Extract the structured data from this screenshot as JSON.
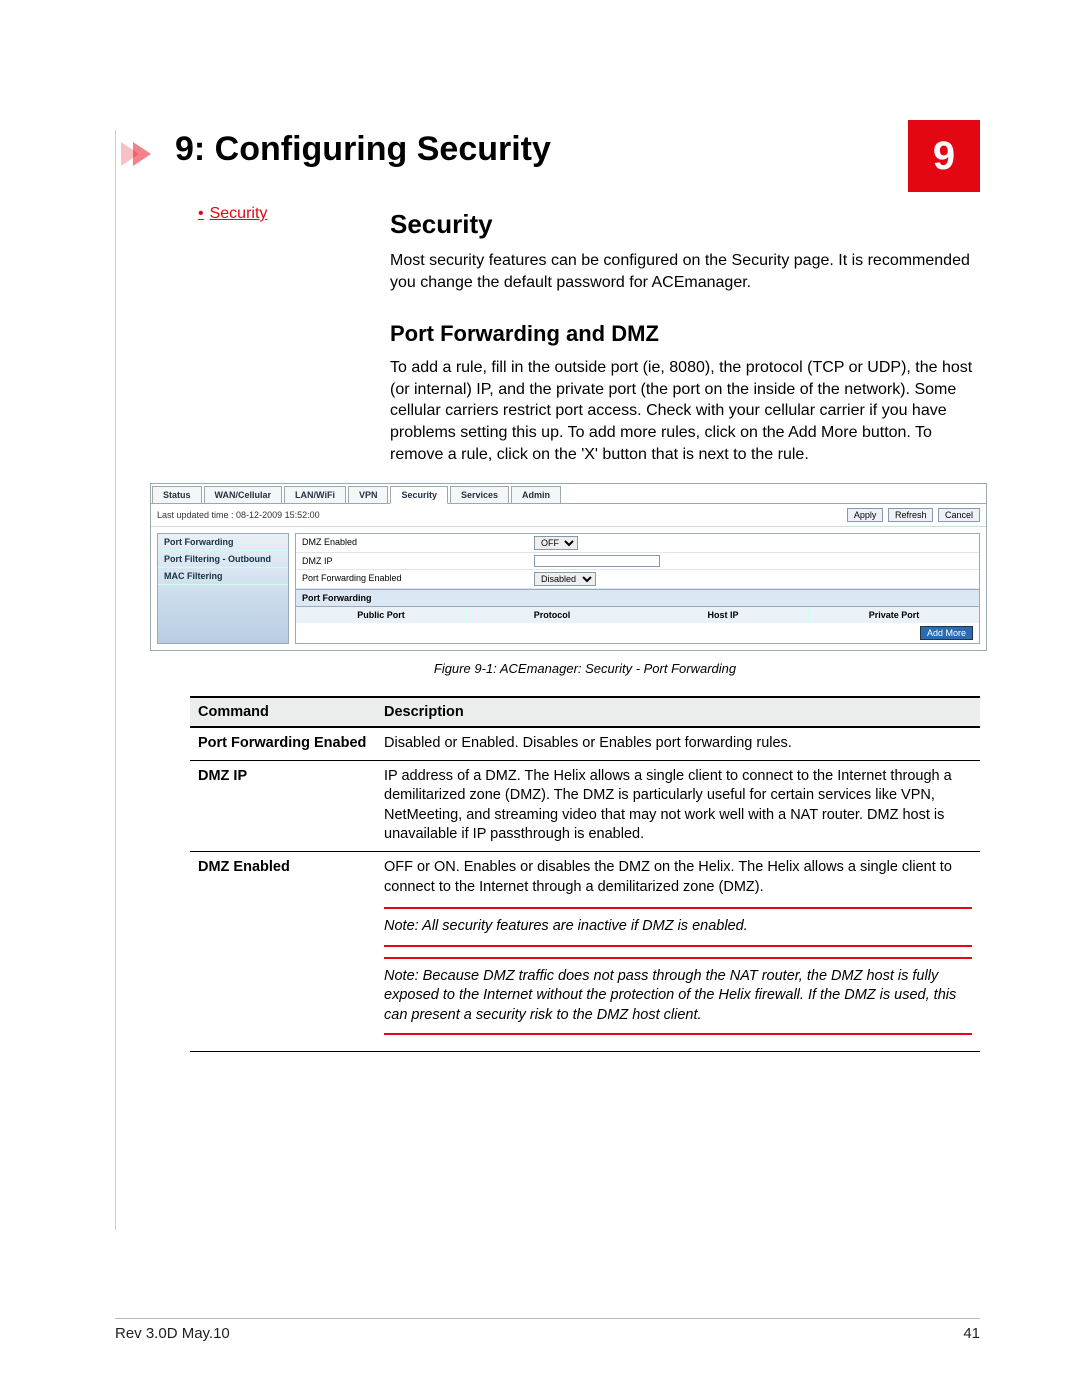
{
  "chapter": {
    "number": "9",
    "title": "9: Configuring Security"
  },
  "toc": {
    "link": "Security"
  },
  "section": {
    "heading": "Security",
    "intro": "Most security features can be configured on the Security page. It is recommended you change the default password for ACEmanager."
  },
  "subsection": {
    "heading": "Port Forwarding and DMZ",
    "body": "To add a rule, fill in the outside port (ie, 8080), the protocol (TCP or UDP), the host (or internal) IP, and the private port (the port on the inside of the network). Some cellular carriers restrict port access. Check with your cellular carrier if you have problems setting this up. To add more rules, click on the Add More button. To remove a rule, click on the 'X' button that is next to the rule."
  },
  "screenshot": {
    "tabs": [
      "Status",
      "WAN/Cellular",
      "LAN/WiFi",
      "VPN",
      "Security",
      "Services",
      "Admin"
    ],
    "active_tab": "Security",
    "last_updated": "Last updated time : 08-12-2009 15:52:00",
    "buttons": {
      "apply": "Apply",
      "refresh": "Refresh",
      "cancel": "Cancel"
    },
    "leftnav": [
      "Port Forwarding",
      "Port Filtering - Outbound",
      "MAC Filtering"
    ],
    "rows": {
      "dmz_enabled_label": "DMZ Enabled",
      "dmz_enabled_value": "OFF",
      "dmz_ip_label": "DMZ IP",
      "dmz_ip_value": "",
      "pf_enabled_label": "Port Forwarding Enabled",
      "pf_enabled_value": "Disabled"
    },
    "pf_section": "Port Forwarding",
    "pf_headers": [
      "Public Port",
      "Protocol",
      "Host IP",
      "Private Port"
    ],
    "add_more": "Add More"
  },
  "figure_caption": "Figure 9-1: ACEmanager: Security - Port Forwarding",
  "table": {
    "headers": {
      "command": "Command",
      "description": "Description"
    },
    "rows": [
      {
        "command": "Port Forwarding Enabed",
        "description": "Disabled or Enabled. Disables or Enables port forwarding rules."
      },
      {
        "command": "DMZ IP",
        "description": "IP address of a DMZ. The Helix allows a single client to connect to the Internet through a demilitarized zone (DMZ). The DMZ is particularly useful for certain services like VPN, NetMeeting, and streaming video that may not work well with a NAT router. DMZ host is unavailable if IP passthrough is enabled."
      },
      {
        "command": "DMZ Enabled",
        "description": "OFF or ON. Enables or disables the DMZ on the Helix. The Helix allows a single client to connect to the Internet through a demilitarized zone (DMZ).",
        "note1": "Note: All security features are inactive if DMZ is enabled.",
        "note2": "Note: Because DMZ traffic does not pass through the NAT router, the DMZ host is fully exposed to the Internet without the protection of the Helix firewall. If the DMZ is used, this can present a security risk to the DMZ host client."
      }
    ]
  },
  "footer": {
    "rev": "Rev 3.0D  May.10",
    "page": "41"
  }
}
